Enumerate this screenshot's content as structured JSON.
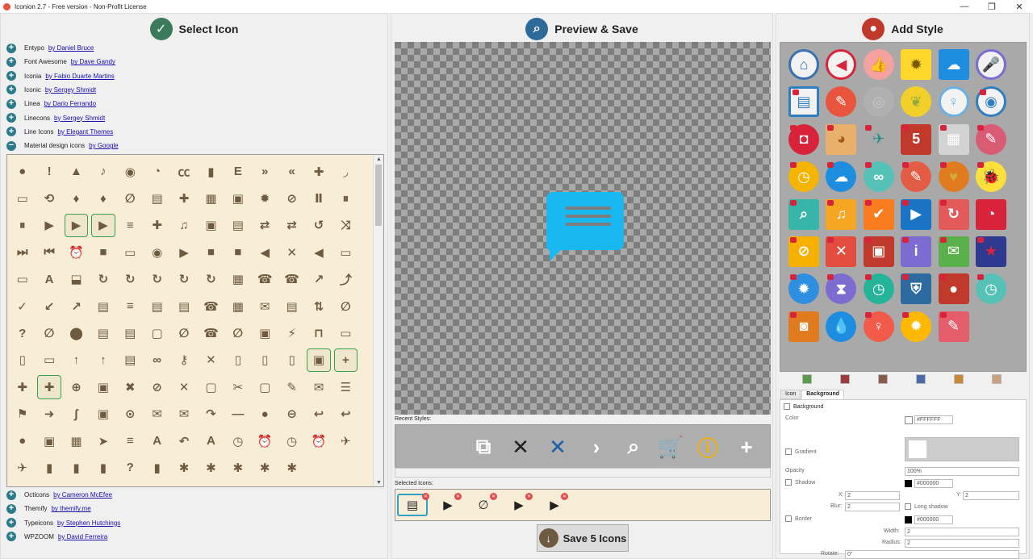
{
  "window": {
    "title": "Iconion 2.7 - Free version - Non-Profit License",
    "min": "—",
    "max": "❐",
    "close": "✕"
  },
  "select_panel": {
    "header": "Select Icon",
    "sets_top": [
      {
        "name": "Entypo",
        "by": "by Daniel Bruce",
        "toggle": "+"
      },
      {
        "name": "Font Awesome",
        "by": "by Dave Gandy",
        "toggle": "+"
      },
      {
        "name": "Iconia",
        "by": "by Fabio Duarte Martins",
        "toggle": "+"
      },
      {
        "name": "Iconic",
        "by": "by Sergey Shmidt",
        "toggle": "+"
      },
      {
        "name": "Linea",
        "by": "by Dario Ferrando",
        "toggle": "+"
      },
      {
        "name": "Linecons",
        "by": "by Sergey Shmidt",
        "toggle": "+"
      },
      {
        "name": "Line Icons",
        "by": "by Elegant Themes",
        "toggle": "+"
      },
      {
        "name": "Material design icons",
        "by": "by Google",
        "toggle": "−"
      }
    ],
    "sets_bottom": [
      {
        "name": "Octicons",
        "by": "by Cameron McEfee",
        "toggle": "+"
      },
      {
        "name": "Themify",
        "by": "by themify.me",
        "toggle": "+"
      },
      {
        "name": "Typeicons",
        "by": "by Stephen Hutchings",
        "toggle": "+"
      },
      {
        "name": "WPZOOM",
        "by": "by David Ferreira",
        "toggle": "+"
      }
    ],
    "glyph_rows": [
      "●!▲♪◉◔㏄▮E»«✚◞",
      "▭⟲♦♦∅▤✚▦▣✹⊘Ⅱ⏸",
      "⏸▶▶▶≡✚♫▣▤⇄⇄↺⤨",
      "⏭⏮⏰■▭◉▶■■◀✕◀",
      "▭▭A⬓↻↻↻↻↻▦☎☎",
      "↗⤴✓↙↗▤≡▤▤☎▦✉▤",
      "⇅∅?∅⬤▤▤▢∅☎∅▣⚡",
      "⊓▭▯▭↑↑▤∞⚷✕▯▯▯",
      "▣+✚✚⊕▣✖⊘✕▢✂▢✎",
      "✉☰⚑➜∫▣⊙✉✉↷—●⊖",
      "↩↩●▣▦➤≡A↶A◷⏰◷",
      "⏰✈✈▮▮▮?▮✱✱✱✱✱"
    ],
    "selected_cells": [
      28,
      29,
      102,
      103,
      105
    ]
  },
  "preview_panel": {
    "header": "Preview & Save",
    "recent_label": "Recent Styles:",
    "recent_styles": [
      "⧉",
      "✕",
      "✕",
      "›",
      "⌕",
      "🛒",
      "ⓘ",
      "+"
    ],
    "selected_label": "Selected Icons:",
    "selected_icons": [
      "▤",
      "▶",
      "∅",
      "▶",
      "▶"
    ],
    "save_label": "Save 5 Icons"
  },
  "style_panel": {
    "header": "Add Style",
    "styles": [
      [
        "⌂",
        "#e8e8e8",
        "#3a6fb0",
        false
      ],
      [
        "◀",
        "#e8e8e8",
        "#d9233a",
        false
      ],
      [
        "👍",
        "#f4a1a0",
        "#e8e8e8",
        false
      ],
      [
        "✹",
        "#ffd62a",
        "#7a5a00",
        false
      ],
      [
        "☁",
        "#1d8de0",
        "#fff",
        false
      ],
      [
        "🎤",
        "#e8e8e8",
        "#7a6ad6",
        false
      ],
      [
        "▤",
        "#e8e8e8",
        "#2f7fc0",
        true
      ],
      [
        "✎",
        "#e9553c",
        "#fff",
        false
      ],
      [
        "◎",
        "#b0b0b0",
        "#c6c6c6",
        false
      ],
      [
        "❦",
        "#f3cf2a",
        "#95a83d",
        false
      ],
      [
        "♀",
        "#e8e8e8",
        "#6ab0e0",
        false
      ],
      [
        "◉",
        "#e8e8e8",
        "#2f7fc0",
        true
      ],
      [
        "◘",
        "#d9233a",
        "#fff",
        true
      ],
      [
        "◕",
        "#e8b06a",
        "#a35a15",
        true
      ],
      [
        "✈",
        "#a9a9a9",
        "#2e8f8a",
        true
      ],
      [
        "5",
        "#c0392b",
        "#fff",
        true
      ],
      [
        "▦",
        "#d3d3d3",
        "#fff",
        true
      ],
      [
        "✎",
        "#d95b74",
        "#fff",
        true
      ],
      [
        "◷",
        "#f5b400",
        "#fff",
        true
      ],
      [
        "☁",
        "#1d8de0",
        "#fff",
        true
      ],
      [
        "∞",
        "#56c1b7",
        "#fff",
        true
      ],
      [
        "✎",
        "#e35d45",
        "#fff",
        true
      ],
      [
        "♥",
        "#e07b20",
        "#d4ab3a",
        true
      ],
      [
        "🐞",
        "#ffe03a",
        "#d4a200",
        true
      ],
      [
        "⌕",
        "#36b5a8",
        "#fff",
        true
      ],
      [
        "♫",
        "#f6a623",
        "#fff",
        true
      ],
      [
        "✔",
        "#f97c1f",
        "#fff",
        true
      ],
      [
        "▶",
        "#1a73c4",
        "#fff",
        true
      ],
      [
        "↻",
        "#e25a5a",
        "#fff",
        true
      ],
      [
        "◔",
        "#d9233a",
        "#fff",
        true
      ],
      [
        "⊘",
        "#f5b000",
        "#fff",
        true
      ],
      [
        "✕",
        "#e34d3f",
        "#fff",
        true
      ],
      [
        "▣",
        "#c0392b",
        "#fff",
        true
      ],
      [
        "i",
        "#7c6bd0",
        "#fff",
        true
      ],
      [
        "✉",
        "#5ab04a",
        "#fff",
        true
      ],
      [
        "★",
        "#2d3a8f",
        "#d9233a",
        true
      ],
      [
        "✹",
        "#2e8fe0",
        "#fff",
        true
      ],
      [
        "⧗",
        "#7c6bd0",
        "#fff",
        true
      ],
      [
        "◷",
        "#25b39a",
        "#fff",
        true
      ],
      [
        "⛨",
        "#2d6aa0",
        "#fff",
        true
      ],
      [
        "●",
        "#c0392b",
        "#fff",
        true
      ],
      [
        "◷",
        "#56c1b7",
        "#fff",
        true
      ],
      [
        "◙",
        "#e07b20",
        "#fff",
        true
      ],
      [
        "💧",
        "#1d8de0",
        "#fff",
        false
      ],
      [
        "♀",
        "#f25a4a",
        "#fff",
        true
      ],
      [
        "✹",
        "#ffb800",
        "#fff",
        true
      ],
      [
        "✎",
        "#e35d6a",
        "#fff",
        true
      ]
    ],
    "swatches": [
      "#5a9a4a",
      "#9c3a40",
      "#8a5a4a",
      "#4a6aa8",
      "#c8883a",
      "#c8a080"
    ],
    "tabs": [
      "Icon",
      "Background"
    ],
    "background_label": "Background",
    "color_label": "Color",
    "color_value": "#FFFFFF",
    "gradient_label": "Gradient",
    "opacity_label": "Opacity",
    "opacity_value": "100%",
    "shadow_label": "Shadow",
    "shadow_color": "#000000",
    "x_label": "X:",
    "x_value": "2",
    "y_label": "Y:",
    "y_value": "2",
    "blur_label": "Blur:",
    "blur_value": "2",
    "long_shadow_label": "Long shadow",
    "border_label": "Border",
    "border_color": "#000000",
    "width_label": "Width:",
    "width_value": "2",
    "radius_label": "Radius:",
    "radius_value": "2",
    "rotate_label": "Rotate:",
    "rotate_value": "0°"
  }
}
